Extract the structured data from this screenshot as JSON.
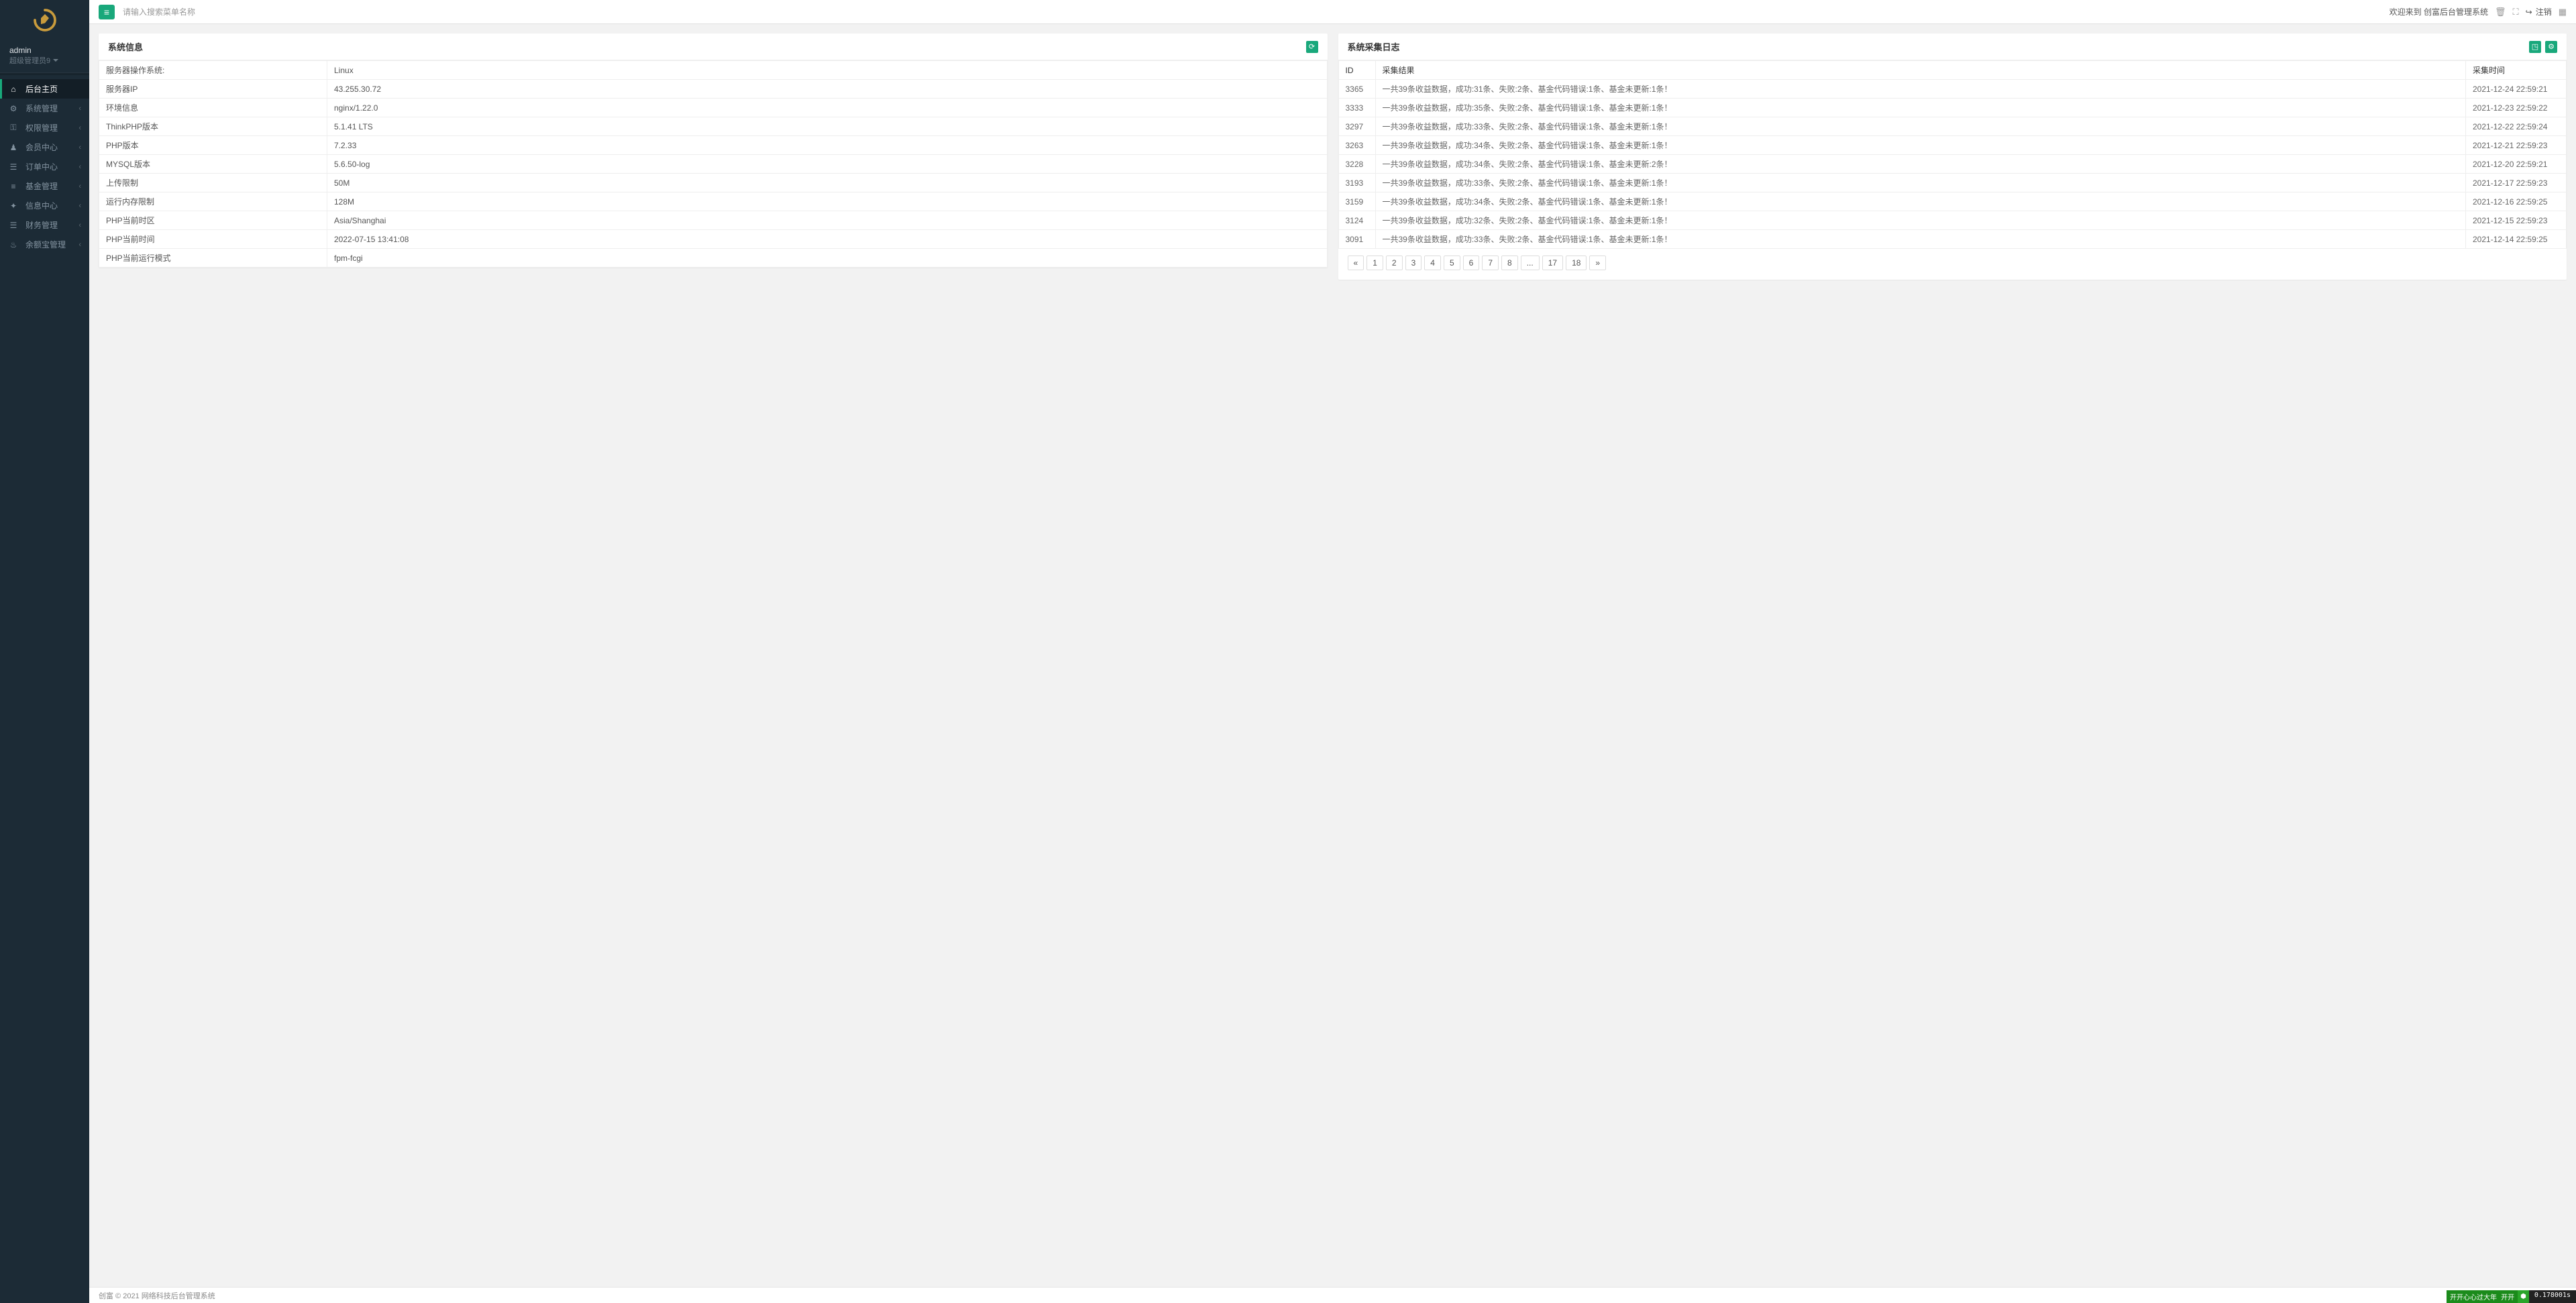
{
  "site": {
    "logo_alt": "logo",
    "user_name": "admin",
    "user_role": "超级管理员9",
    "search_placeholder": "请输入搜索菜单名称",
    "welcome_text": "欢迎来到 创富后台管理系统",
    "logout_label": "注销",
    "footer_text": "创富 © 2021 网络科技后台管理系统",
    "perf_text1": "开开心心过大年 开开",
    "perf_time": "0.178001s"
  },
  "nav": [
    {
      "icon": "home",
      "label": "后台主页",
      "active": true,
      "expandable": false
    },
    {
      "icon": "gear",
      "label": "系统管理",
      "active": false,
      "expandable": true
    },
    {
      "icon": "lock",
      "label": "权限管理",
      "active": false,
      "expandable": true
    },
    {
      "icon": "user",
      "label": "会员中心",
      "active": false,
      "expandable": true
    },
    {
      "icon": "list",
      "label": "订单中心",
      "active": false,
      "expandable": true
    },
    {
      "icon": "chart",
      "label": "基金管理",
      "active": false,
      "expandable": true
    },
    {
      "icon": "info",
      "label": "信息中心",
      "active": false,
      "expandable": true
    },
    {
      "icon": "money",
      "label": "财务管理",
      "active": false,
      "expandable": true
    },
    {
      "icon": "fire",
      "label": "余额宝管理",
      "active": false,
      "expandable": true
    }
  ],
  "sysinfo": {
    "title": "系统信息",
    "rows": [
      {
        "k": "服务器操作系统:",
        "v": "Linux"
      },
      {
        "k": "服务器IP",
        "v": "43.255.30.72"
      },
      {
        "k": "环境信息",
        "v": "nginx/1.22.0"
      },
      {
        "k": "ThinkPHP版本",
        "v": "5.1.41 LTS"
      },
      {
        "k": "PHP版本",
        "v": "7.2.33"
      },
      {
        "k": "MYSQL版本",
        "v": "5.6.50-log"
      },
      {
        "k": "上传限制",
        "v": "50M"
      },
      {
        "k": "运行内存限制",
        "v": "128M"
      },
      {
        "k": "PHP当前时区",
        "v": "Asia/Shanghai"
      },
      {
        "k": "PHP当前时间",
        "v": "2022-07-15 13:41:08"
      },
      {
        "k": "PHP当前运行模式",
        "v": "fpm-fcgi"
      }
    ]
  },
  "log": {
    "title": "系统采集日志",
    "headers": {
      "id": "ID",
      "result": "采集结果",
      "time": "采集时间"
    },
    "rows": [
      {
        "id": "3365",
        "result": "一共39条收益数据，成功:31条、失败:2条、基金代码错误:1条、基金未更新:1条！",
        "time": "2021-12-24 22:59:21"
      },
      {
        "id": "3333",
        "result": "一共39条收益数据，成功:35条、失败:2条、基金代码错误:1条、基金未更新:1条！",
        "time": "2021-12-23 22:59:22"
      },
      {
        "id": "3297",
        "result": "一共39条收益数据，成功:33条、失败:2条、基金代码错误:1条、基金未更新:1条！",
        "time": "2021-12-22 22:59:24"
      },
      {
        "id": "3263",
        "result": "一共39条收益数据，成功:34条、失败:2条、基金代码错误:1条、基金未更新:1条！",
        "time": "2021-12-21 22:59:23"
      },
      {
        "id": "3228",
        "result": "一共39条收益数据，成功:34条、失败:2条、基金代码错误:1条、基金未更新:2条！",
        "time": "2021-12-20 22:59:21"
      },
      {
        "id": "3193",
        "result": "一共39条收益数据，成功:33条、失败:2条、基金代码错误:1条、基金未更新:1条！",
        "time": "2021-12-17 22:59:23"
      },
      {
        "id": "3159",
        "result": "一共39条收益数据，成功:34条、失败:2条、基金代码错误:1条、基金未更新:1条！",
        "time": "2021-12-16 22:59:25"
      },
      {
        "id": "3124",
        "result": "一共39条收益数据，成功:32条、失败:2条、基金代码错误:1条、基金未更新:1条！",
        "time": "2021-12-15 22:59:23"
      },
      {
        "id": "3091",
        "result": "一共39条收益数据，成功:33条、失败:2条、基金代码错误:1条、基金未更新:1条！",
        "time": "2021-12-14 22:59:25"
      }
    ],
    "pages": [
      "«",
      "1",
      "2",
      "3",
      "4",
      "5",
      "6",
      "7",
      "8",
      "...",
      "17",
      "18",
      "»"
    ]
  }
}
